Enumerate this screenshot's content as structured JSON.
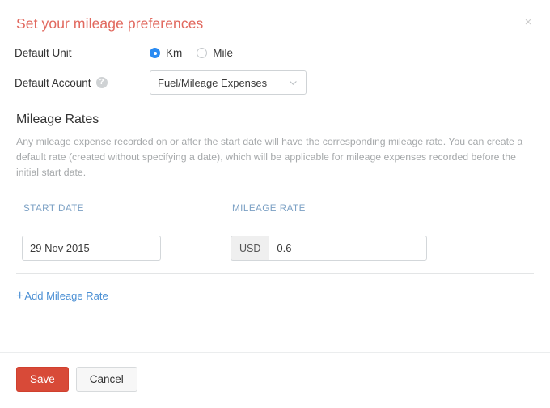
{
  "dialog": {
    "title": "Set your mileage preferences",
    "close_icon": "close-icon",
    "close_label": "×"
  },
  "form": {
    "default_unit": {
      "label": "Default Unit",
      "selected": "Km",
      "options": [
        {
          "label": "Km",
          "selected": true
        },
        {
          "label": "Mile",
          "selected": false
        }
      ]
    },
    "default_account": {
      "label": "Default Account",
      "help_icon": "help-icon",
      "help_glyph": "?",
      "value": "Fuel/Mileage Expenses",
      "chevron_icon": "chevron-down-icon"
    }
  },
  "mileage_rates": {
    "heading": "Mileage Rates",
    "description": "Any mileage expense recorded on or after the start date will have the corresponding mileage rate. You can create a default rate (created without specifying a date), which will be applicable for mileage expenses recorded before the initial start date.",
    "columns": [
      "START DATE",
      "MILEAGE RATE"
    ],
    "rows": [
      {
        "start_date": "29 Nov 2015",
        "currency": "USD",
        "rate": "0.6"
      }
    ],
    "add_link": {
      "plus": "+",
      "label": "Add Mileage Rate"
    }
  },
  "footer": {
    "save_label": "Save",
    "cancel_label": "Cancel"
  },
  "colors": {
    "title": "#e1685e",
    "primary_button": "#d84a38",
    "link": "#4a8fd4",
    "column_header": "#7ba0c4",
    "radio_selected": "#2a8bf2",
    "description": "#a6a9ab"
  }
}
